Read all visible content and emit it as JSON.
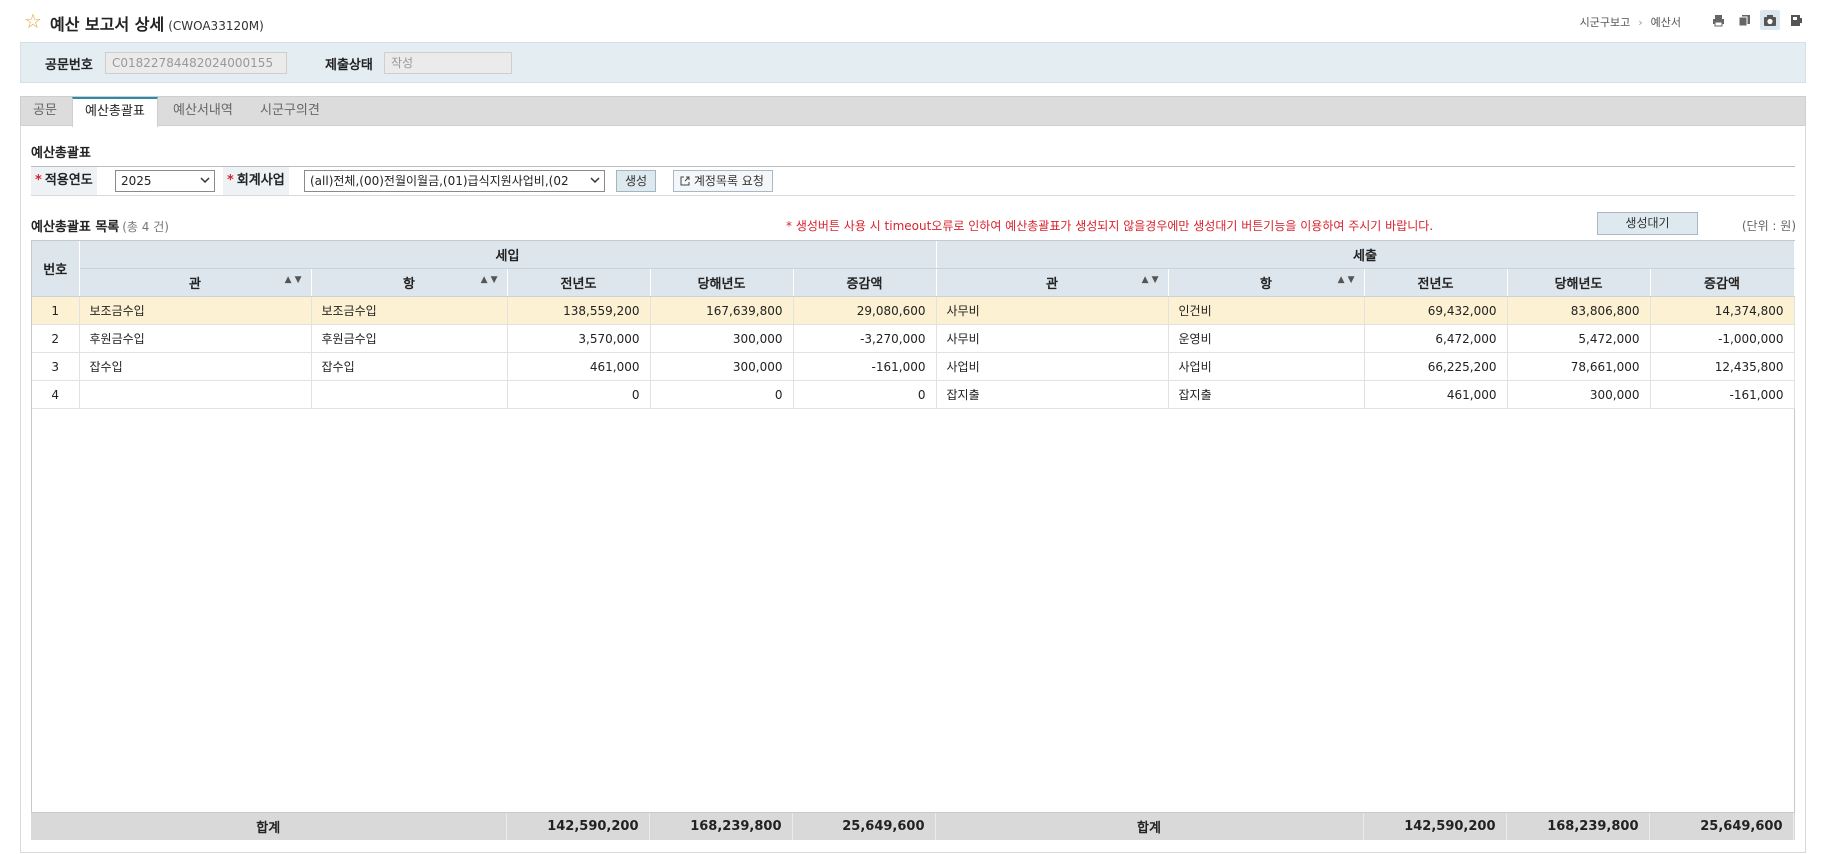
{
  "header": {
    "title": "예산 보고서 상세",
    "code": "(CWOA33120M)",
    "breadcrumb": [
      "시군구보고",
      "예산서"
    ],
    "icons": [
      "print-icon",
      "copy-icon",
      "camera-icon",
      "settings-icon"
    ]
  },
  "info": {
    "doc_no_label": "공문번호",
    "doc_no_value": "C01822784482024000155",
    "status_label": "제출상태",
    "status_value": "작성"
  },
  "tabs": [
    {
      "label": "공문"
    },
    {
      "label": "예산총괄표",
      "active": true
    },
    {
      "label": "예산서내역"
    },
    {
      "label": "시군구의견"
    }
  ],
  "section_title": "예산총괄표",
  "filters": {
    "year_label": "적용연도",
    "year_value": "2025",
    "account_label": "회계사업",
    "account_value": "(all)전체,(00)전월이월금,(01)급식지원사업비,(02",
    "create_btn": "생성",
    "request_btn": "계정목록 요청"
  },
  "list": {
    "title": "예산총괄표 목록",
    "count": "(총 4 건)",
    "warning": "* 생성버튼 사용 시 timeout오류로 인하여 예산총괄표가 생성되지 않을경우에만 생성대기 버튼기능을 이용하여 주시기 바랍니다.",
    "wait_btn": "생성대기",
    "unit": "(단위 : 원)"
  },
  "grid": {
    "col_no": "번호",
    "group_income": "세입",
    "group_expense": "세출",
    "cols": [
      "관",
      "항",
      "전년도",
      "당해년도",
      "증감액",
      "관",
      "항",
      "전년도",
      "당해년도",
      "증감액"
    ],
    "rows": [
      [
        "1",
        "보조금수입",
        "보조금수입",
        "138,559,200",
        "167,639,800",
        "29,080,600",
        "사무비",
        "인건비",
        "69,432,000",
        "83,806,800",
        "14,374,800"
      ],
      [
        "2",
        "후원금수입",
        "후원금수입",
        "3,570,000",
        "300,000",
        "-3,270,000",
        "사무비",
        "운영비",
        "6,472,000",
        "5,472,000",
        "-1,000,000"
      ],
      [
        "3",
        "잡수입",
        "잡수입",
        "461,000",
        "300,000",
        "-161,000",
        "사업비",
        "사업비",
        "66,225,200",
        "78,661,000",
        "12,435,800"
      ],
      [
        "4",
        "",
        "",
        "0",
        "0",
        "0",
        "잡지출",
        "잡지출",
        "461,000",
        "300,000",
        "-161,000"
      ]
    ],
    "footer": {
      "income_label": "합계",
      "income_prev": "142,590,200",
      "income_curr": "168,239,800",
      "income_diff": "25,649,600",
      "expense_label": "합계",
      "expense_prev": "142,590,200",
      "expense_curr": "168,239,800",
      "expense_diff": "25,649,600"
    }
  }
}
